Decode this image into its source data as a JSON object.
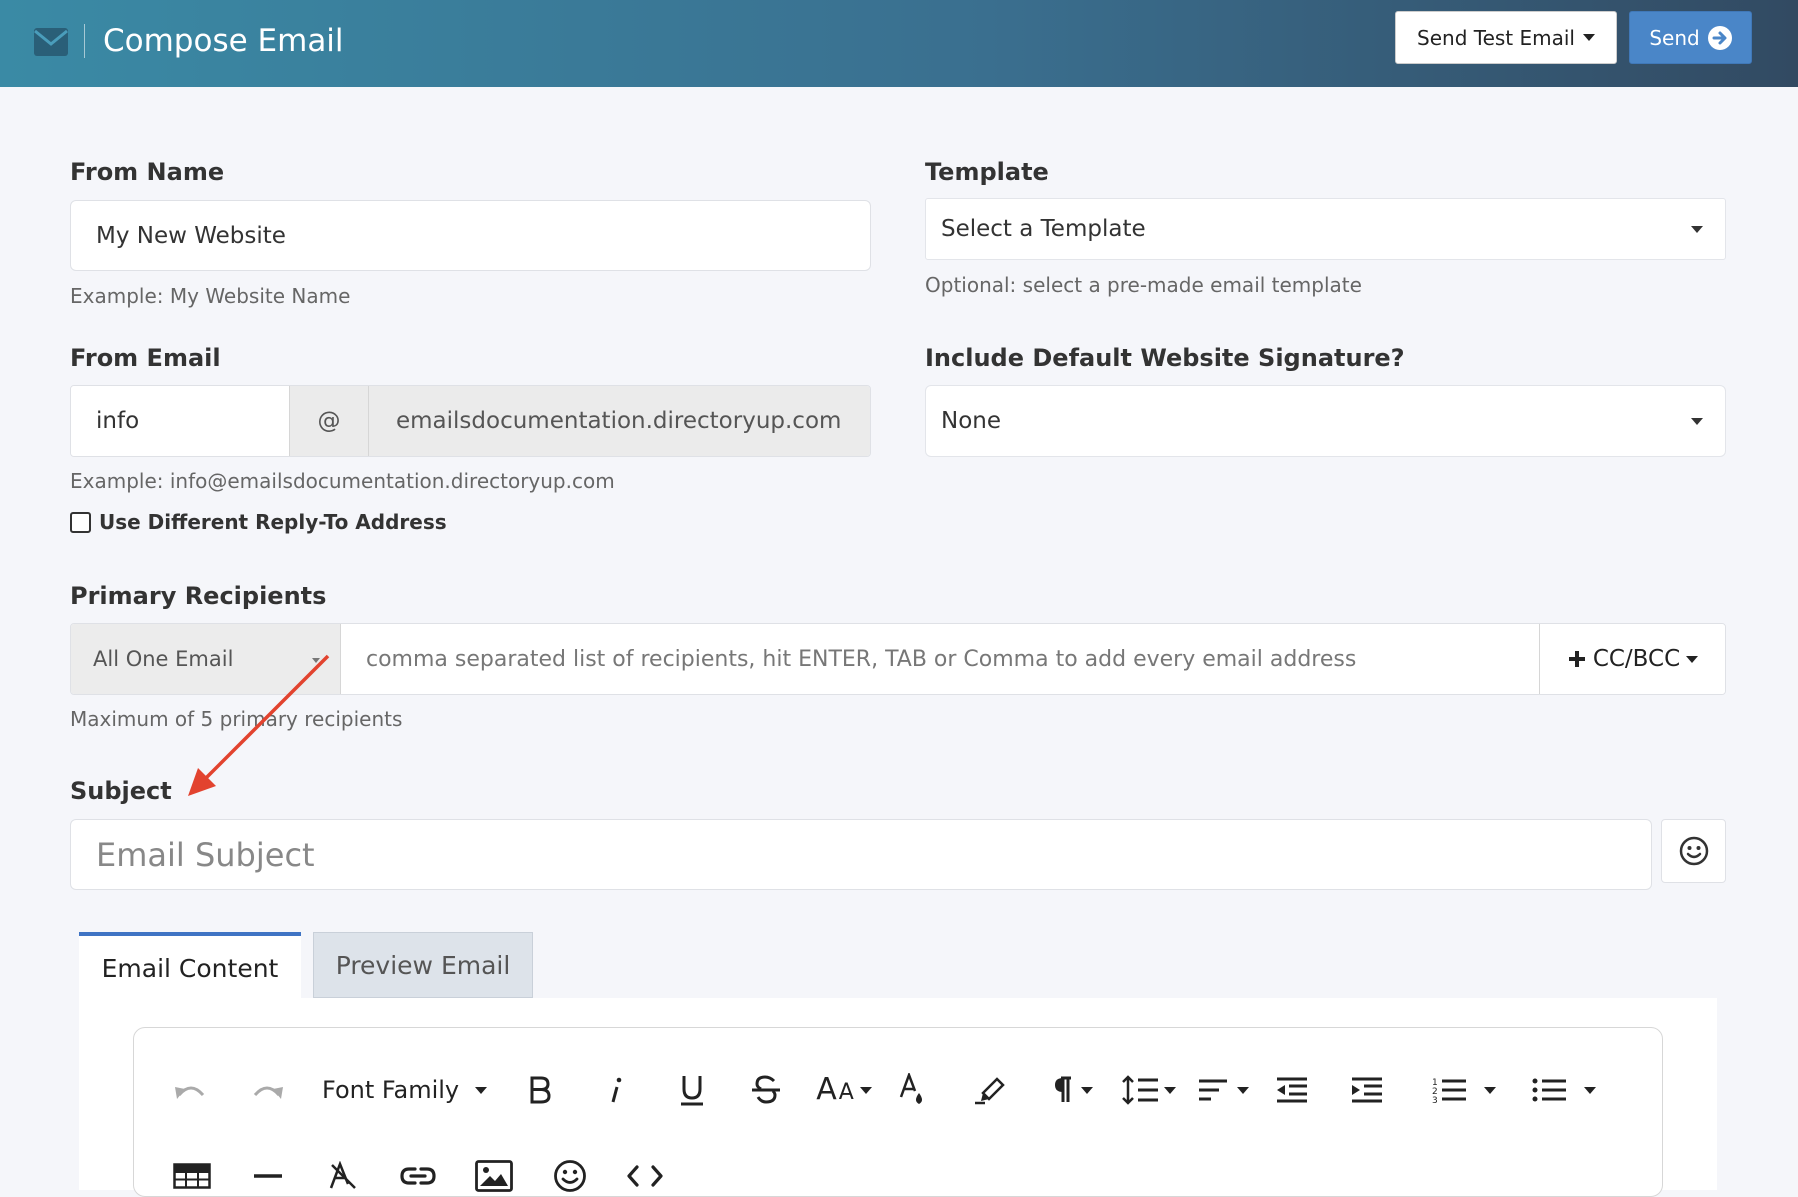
{
  "header": {
    "title": "Compose Email",
    "send_test_label": "Send Test Email",
    "send_label": "Send"
  },
  "from_name": {
    "label": "From Name",
    "value": "My New Website",
    "help": "Example: My Website Name"
  },
  "template": {
    "label": "Template",
    "selected": "Select a Template",
    "help": "Optional: select a pre-made email template"
  },
  "from_email": {
    "label": "From Email",
    "local_part": "info",
    "at": "@",
    "domain": "emailsdocumentation.directoryup.com",
    "help": "Example: info@emailsdocumentation.directoryup.com"
  },
  "signature": {
    "label": "Include Default Website Signature?",
    "selected": "None"
  },
  "reply_to": {
    "label": "Use Different Reply-To Address",
    "checked": false
  },
  "recipients": {
    "label": "Primary Recipients",
    "mode": "All One Email",
    "placeholder": "comma separated list of recipients, hit ENTER, TAB or Comma to add every email address",
    "cc_bcc_label": "CC/BCC",
    "help": "Maximum of 5 primary recipients"
  },
  "subject": {
    "label": "Subject",
    "placeholder": "Email Subject"
  },
  "tabs": [
    {
      "label": "Email Content",
      "active": true
    },
    {
      "label": "Preview Email",
      "active": false
    }
  ],
  "toolbar": {
    "font_family_label": "Font Family",
    "size_label": "A",
    "size_label_small": "A",
    "row1_icons": [
      "undo-icon",
      "redo-icon",
      "bold-icon",
      "italic-icon",
      "underline-icon",
      "strikethrough-icon",
      "font-size-icon",
      "text-color-icon",
      "highlight-icon",
      "paragraph-icon",
      "line-height-icon",
      "align-icon",
      "outdent-icon",
      "indent-icon",
      "ordered-list-icon",
      "unordered-list-icon"
    ],
    "row2_icons": [
      "table-icon",
      "horizontal-rule-icon",
      "clear-format-icon",
      "link-icon",
      "image-icon",
      "emoji-icon",
      "code-view-icon"
    ]
  },
  "colors": {
    "header_start": "#3a8aa5",
    "header_end": "#324a62",
    "send_button": "#4a86c8",
    "active_tab": "#3f74c4",
    "annotation_arrow": "#e2432f"
  }
}
